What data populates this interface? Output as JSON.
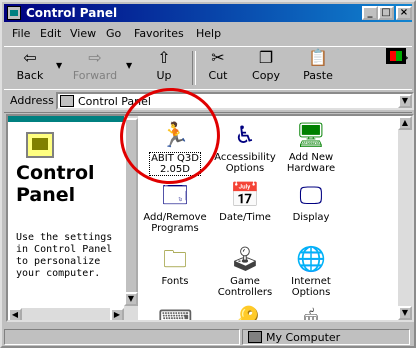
{
  "window": {
    "title": "Control Panel",
    "controls": {
      "minimize": "_",
      "maximize": "□",
      "close": "×"
    }
  },
  "menu": [
    "File",
    "Edit",
    "View",
    "Go",
    "Favorites",
    "Help"
  ],
  "toolbar": {
    "back": "Back",
    "forward": "Forward",
    "up": "Up",
    "cut": "Cut",
    "copy": "Copy",
    "paste": "Paste",
    "more": "»"
  },
  "address": {
    "label": "Address",
    "value": "Control Panel"
  },
  "left_panel": {
    "title_line1": "Control",
    "title_line2": "Panel",
    "description": "Use the settings in Control Panel to personalize your computer."
  },
  "items": [
    {
      "label_l1": "ABIT Q3D",
      "label_l2": "2.05D",
      "icon": "abit-icon",
      "selected": true
    },
    {
      "label_l1": "Accessibility",
      "label_l2": "Options",
      "icon": "accessibility-icon"
    },
    {
      "label_l1": "Add New",
      "label_l2": "Hardware",
      "icon": "hardware-icon"
    },
    {
      "label_l1": "Add/Remove",
      "label_l2": "Programs",
      "icon": "programs-icon"
    },
    {
      "label_l1": "Date/Time",
      "label_l2": "",
      "icon": "calendar-icon"
    },
    {
      "label_l1": "Display",
      "label_l2": "",
      "icon": "display-icon"
    },
    {
      "label_l1": "Fonts",
      "label_l2": "",
      "icon": "fonts-icon"
    },
    {
      "label_l1": "Game",
      "label_l2": "Controllers",
      "icon": "joystick-icon"
    },
    {
      "label_l1": "Internet",
      "label_l2": "Options",
      "icon": "internet-icon"
    }
  ],
  "annotation_color": "#e00000",
  "status": {
    "location": "My Computer"
  }
}
